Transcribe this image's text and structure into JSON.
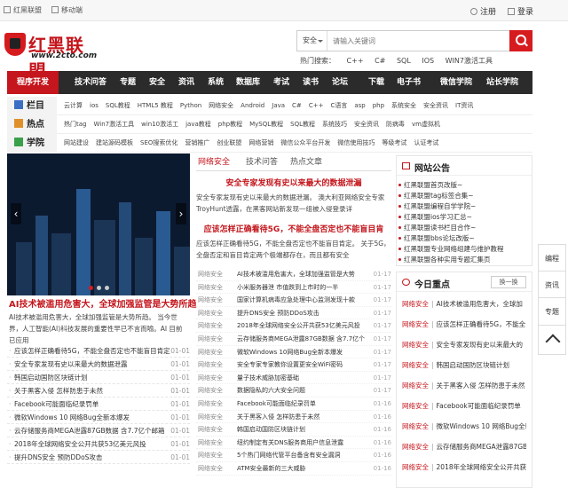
{
  "topbar": {
    "home": "红黑联盟",
    "mobile": "移动端",
    "register": "注册",
    "login": "登录"
  },
  "logo": {
    "name": "红黑联盟",
    "url": "www.2cto.com"
  },
  "search": {
    "scope": "安全",
    "placeholder": "请输入关键词"
  },
  "hot_search": {
    "label": "热门搜索：",
    "items": [
      "C++",
      "C#",
      "SQL",
      "IOS",
      "WIN7激活工具"
    ]
  },
  "nav": [
    "程序开发",
    "技术问答",
    "专题",
    "安全",
    "资讯",
    "系统",
    "数据库",
    "考试",
    "读书",
    "论坛",
    "下载",
    "电子书",
    "微信学院",
    "站长学院"
  ],
  "categories": [
    {
      "label": "栏目",
      "links": [
        "云计算",
        "ios",
        "SQL教程",
        "HTML5 教程",
        "Python",
        "网络安全",
        "Android",
        "Java",
        "C#",
        "C++",
        "C语言",
        "asp",
        "php",
        "系统安全",
        "安全资讯",
        "IT资讯"
      ]
    },
    {
      "label": "热点",
      "links": [
        "热门tag",
        "Win7激活工具",
        "win10激活工",
        "java教程",
        "php教程",
        "MySQL教程",
        "SQL教程",
        "系统技巧",
        "安全资讯",
        "防病毒",
        "vm虚拟机"
      ]
    },
    {
      "label": "学院",
      "links": [
        "网站建设",
        "建站源码模板",
        "SEO搜索优化",
        "营销推广",
        "创业联盟",
        "网络营销",
        "微信公众平台开发",
        "微信使用技巧",
        "等级考试",
        "认证考试"
      ]
    }
  ],
  "slider": {
    "title": "AI技术被滥用危害大，全球加强监管是大势所趋",
    "desc": "AI技术被滥用危害大，全球加强监管是大势所趋。 当今世界，人工智能(AI)科技发展的重要性早已不言而喻。AI 目前已应用"
  },
  "left_list": [
    {
      "title": "应该怎样正确看待5G，不能全盘否定也不能盲目肯定",
      "date": "01-01"
    },
    {
      "title": "安全专家发现有史以来最大的数据泄露",
      "date": "01-01"
    },
    {
      "title": "韩国启动国防区块链计划",
      "date": "01-01"
    },
    {
      "title": "关于黑客入侵 怎样防患于未然",
      "date": "01-01"
    },
    {
      "title": "Facebook可能面临纪录罚单",
      "date": "01-01"
    },
    {
      "title": "微软Windows 10 网络Bug全新本爆发",
      "date": "01-01"
    },
    {
      "title": "云存储服务商MEGA泄露87GB数据 含7.7亿个邮箱",
      "date": "01-01"
    },
    {
      "title": "2018年全球网络安全公开共获53亿美元风投",
      "date": "01-01"
    },
    {
      "title": "提升DNS安全 预防DDoS攻击",
      "date": "01-01"
    }
  ],
  "tabs": [
    "网络安全",
    "技术问答",
    "热点文章"
  ],
  "articles": [
    {
      "title": "安全专家发现有史以来最大的数据泄漏",
      "body": "安全专家发现有史以来最大的数据泄漏。 澳大利亚网络安全专家TroyHunt透露，在黑客网站新发现一组被入侵登录详"
    },
    {
      "title": "应该怎样正确看待5G，不能全盘否定也不能盲目肯",
      "body": "应该怎样正确看待5G，不能全盘否定也不能盲目肯定。 关于5G，全盘否定和盲目肯定两个极端都存在，而且都有安全"
    }
  ],
  "mid_list": [
    {
      "cat": "网络安全",
      "title": "AI技术被滥用危害大，全球加强监管是大势",
      "date": "01-17"
    },
    {
      "cat": "网络安全",
      "title": "小米服务器泄 市值跌到上市时的一半",
      "date": "01-17"
    },
    {
      "cat": "网络安全",
      "title": "国家计算机病毒应急处理中心监测发现十款",
      "date": "01-17"
    },
    {
      "cat": "网络安全",
      "title": "提升DNS安全 预防DDoS攻击",
      "date": "01-17"
    },
    {
      "cat": "网络安全",
      "title": "2018年全球网络安全公开共获53亿美元风投",
      "date": "01-17"
    },
    {
      "cat": "网络安全",
      "title": "云存储服务商MEGA泄露87GB数据 含7.7亿个",
      "date": "01-17"
    },
    {
      "cat": "网络安全",
      "title": "微软Windows 10网络Bug全新本爆发",
      "date": "01-17"
    },
    {
      "cat": "网络安全",
      "title": "安全专家专家教你设置更安全WiFi密码",
      "date": "01-17"
    },
    {
      "cat": "网络安全",
      "title": "量子技术威胁加密基础",
      "date": "01-17"
    },
    {
      "cat": "网络安全",
      "title": "数据隐私的六大安全问题",
      "date": "01-17"
    },
    {
      "cat": "网络安全",
      "title": "Facebook可能面临纪录罚单",
      "date": "01-16"
    },
    {
      "cat": "网络安全",
      "title": "关于黑客入侵 怎样防患于未然",
      "date": "01-16"
    },
    {
      "cat": "网络安全",
      "title": "韩国启动国防区块链计划",
      "date": "01-16"
    },
    {
      "cat": "网络安全",
      "title": "纽约制定有关DNS服务商用户信息泄露",
      "date": "01-16"
    },
    {
      "cat": "网络安全",
      "title": "5个热门网络代管平台备含有安全漏洞",
      "date": "01-16"
    },
    {
      "cat": "网络安全",
      "title": "ATM安全最新的三大威胁",
      "date": "01-16"
    }
  ],
  "notice": {
    "title": "网站公告",
    "items": [
      "红黑联盟首页改版~",
      "红黑联盟tag标签合集~",
      "红黑联盟编程自学学院~",
      "红黑联盟ios学习汇总~",
      "红黑联盟读书栏目合作~",
      "红黑联盟bbs论坛改版~",
      "红黑联盟专业网络组建与维护教程",
      "红黑联盟各种实用专题汇集页"
    ]
  },
  "focus": {
    "title": "今日重点",
    "swap": "换一换",
    "items": [
      {
        "cat": "网络安全",
        "title": "AI技术被滥用危害大，全球加"
      },
      {
        "cat": "网络安全",
        "title": "应该怎样正确看待5G，不能全"
      },
      {
        "cat": "网络安全",
        "title": "安全专家发现有史以来最大的"
      },
      {
        "cat": "网络安全",
        "title": "韩国启动国防区块链计划"
      },
      {
        "cat": "网络安全",
        "title": "关于黑客入侵 怎样防患于未然"
      },
      {
        "cat": "网络安全",
        "title": "Facebook可能面临纪录罚单"
      },
      {
        "cat": "网络安全",
        "title": "微软Windows 10 网络Bug全新"
      },
      {
        "cat": "网络安全",
        "title": "云存储服务商MEGA泄露87GB"
      },
      {
        "cat": "网络安全",
        "title": "2018年全球网络安全公开共获"
      }
    ]
  },
  "side_tools": [
    "编程",
    "资讯",
    "专题"
  ],
  "colors": {
    "brand_red": "#c4161c",
    "nav_dark": "#2b2b2b"
  }
}
